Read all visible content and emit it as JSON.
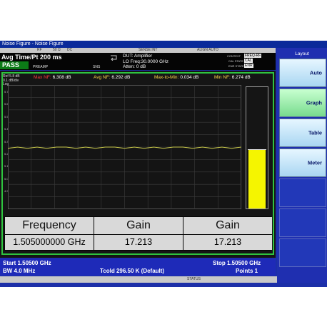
{
  "window": {
    "title": "Noise Figure - Noise Figure"
  },
  "top_strip": {
    "items": [
      "RF",
      "50 Ω",
      "DC",
      "SENSE:INT",
      "ALIGN AUTO"
    ]
  },
  "status": {
    "avg": "Avg Time/Pt 200 ms",
    "pass": "PASS",
    "preamp": "PREAMP",
    "sns": "SNS",
    "dut": "DUT: Amplifier",
    "lo_freq": "LO Freq:30.0000 GHz",
    "atten": "Atten: 0 dB",
    "context_label": "CONTEXT",
    "context_val": "FREQ-RF",
    "cal_label": "CAL STATE",
    "cal_val": "CAL",
    "enr_label": "ENR STATE",
    "enr_val": "ENR"
  },
  "stats": {
    "ref": "Ref 5.8 dB",
    "scale": "0.1 dB/div",
    "log": "Log",
    "max_label": "Max NF:",
    "max_val": "6.308 dB",
    "avg_label": "Avg NF:",
    "avg_val": "6.292 dB",
    "m2m_label": "Max-to-Min:",
    "m2m_val": "0.034 dB",
    "min_label": "Min NF:",
    "min_val": "6.274 dB"
  },
  "y_ticks": [
    "5.7",
    "5.6",
    "5.5",
    "5.4",
    "5.3",
    "5.2",
    "5.1",
    "5.0",
    "4.9"
  ],
  "chart_data": {
    "type": "line",
    "series": [
      {
        "values": [
          5.29,
          5.3,
          5.29,
          5.3,
          5.29,
          5.3,
          5.3,
          5.29,
          5.3,
          5.29,
          5.3,
          5.3,
          5.29,
          5.3,
          5.29,
          5.3,
          5.29,
          5.3,
          5.3,
          5.29,
          5.3,
          5.29,
          5.3,
          5.29,
          5.3
        ]
      }
    ],
    "ylim": [
      4.8,
      5.8
    ],
    "grid": true,
    "meter": {
      "value": 5.29,
      "min": 4.8,
      "max": 5.8
    }
  },
  "table": {
    "headers": [
      "Frequency",
      "Gain",
      "Gain"
    ],
    "values": [
      "1.505000000 GHz",
      "17.213",
      "17.213"
    ]
  },
  "footer": {
    "start": "Start 1.50500 GHz",
    "stop": "Stop 1.50500 GHz",
    "bw": "BW 4.0 MHz",
    "tcold": "Tcold 296.50 K (Default)",
    "points": "Points 1"
  },
  "statusbar": {
    "status": "STATUS"
  },
  "menu": {
    "title": "Layout",
    "buttons": [
      "Auto",
      "Graph",
      "Table",
      "Meter"
    ]
  },
  "colors": {
    "accent_green": "#2fc33f",
    "trace": "#c8c84a",
    "meter": "#f5f500",
    "max_label": "#ff3b3b",
    "avg_label": "#ffd84a"
  }
}
